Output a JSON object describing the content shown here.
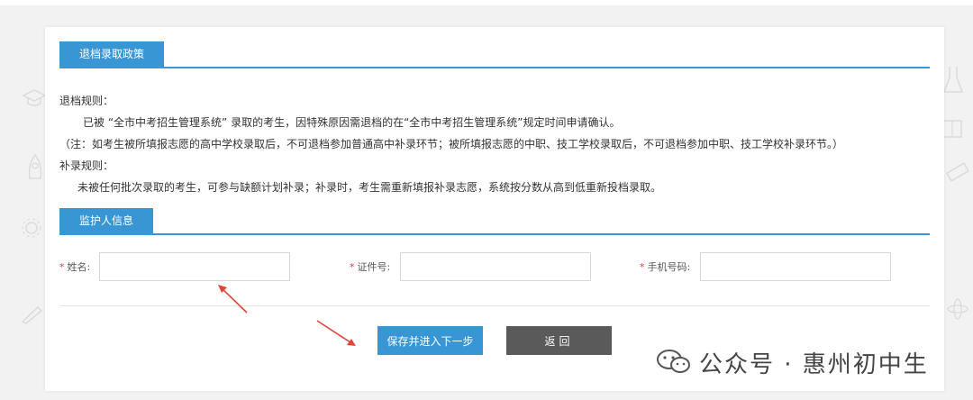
{
  "policy_section": {
    "title": "退档录取政策",
    "rules": {
      "withdraw_heading": "退档规则：",
      "withdraw_text": "已被 “全市中考招生管理系统” 录取的考生，因特殊原因需退档的在“全市中考招生管理系统”规定时间申请确认。",
      "withdraw_note": "（注：如考生被所填报志愿的高中学校录取后，不可退档参加普通高中补录环节；被所填报志愿的中职、技工学校录取后，不可退档参加中职、技工学校补录环节。）",
      "supplement_heading": "补录规则：",
      "supplement_text": "未被任何批次录取的考生，可参与缺额计划补录；补录时，考生需重新填报补录志愿，系统按分数从高到低重新投档录取。"
    }
  },
  "guardian_section": {
    "title": "监护人信息",
    "fields": {
      "name_label": "姓名:",
      "name_value": "",
      "id_label": "证件号:",
      "id_value": "",
      "phone_label": "手机号码:",
      "phone_value": "",
      "required_mark": "*"
    }
  },
  "actions": {
    "save_next_label": "保存并进入下一步",
    "back_label": "返回"
  },
  "watermark": {
    "text": "公众号 · 惠州初中生"
  },
  "colors": {
    "accent": "#3996d5",
    "back_button": "#5a5a5a",
    "required": "#e03a3a",
    "arrow": "#e0453a"
  }
}
